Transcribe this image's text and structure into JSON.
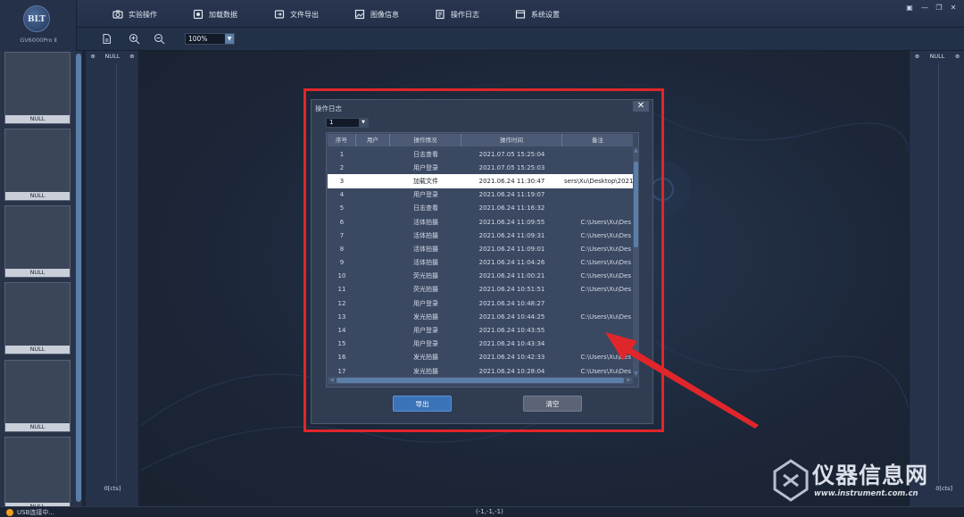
{
  "app": {
    "logo_text": "BLT",
    "product_name": "GV6000Pro Ⅱ"
  },
  "menu": [
    {
      "label": "实验操作",
      "icon": "camera-icon"
    },
    {
      "label": "加载数据",
      "icon": "load-data-icon"
    },
    {
      "label": "文件导出",
      "icon": "folder-export-icon"
    },
    {
      "label": "图像信息",
      "icon": "image-info-icon"
    },
    {
      "label": "操作日志",
      "icon": "log-icon"
    },
    {
      "label": "系统设置",
      "icon": "settings-icon"
    }
  ],
  "toolbar": {
    "zoom_value": "100%"
  },
  "thumbnails": [
    "NULL",
    "NULL",
    "NULL",
    "NULL",
    "NULL",
    "NULL"
  ],
  "left_panel": {
    "title": "NULL",
    "footer": "0[cts]"
  },
  "right_panel": {
    "title": "NULL",
    "footer": "0[cts]"
  },
  "dialog": {
    "title": "操作日志",
    "close_label": "✕",
    "page_value": "1",
    "columns": [
      "序号",
      "用户",
      "操作情况",
      "操作时间",
      "备注"
    ],
    "rows": [
      {
        "no": "1",
        "user": "",
        "op": "日志查看",
        "time": "2021.07.05 15:25:04",
        "note": ""
      },
      {
        "no": "2",
        "user": "",
        "op": "用户登录",
        "time": "2021.07.05 15:25:03",
        "note": ""
      },
      {
        "no": "3",
        "user": "",
        "op": "加载文件",
        "time": "2021.06.24 11:30:47",
        "note": "sers\\Xu\\Desktop\\2021"
      },
      {
        "no": "4",
        "user": "",
        "op": "用户登录",
        "time": "2021.06.24 11:19:07",
        "note": ""
      },
      {
        "no": "5",
        "user": "",
        "op": "日志查看",
        "time": "2021.06.24 11:16:32",
        "note": ""
      },
      {
        "no": "6",
        "user": "",
        "op": "活体拍摄",
        "time": "2021.06.24 11:09:55",
        "note": "C:\\Users\\Xu\\Des"
      },
      {
        "no": "7",
        "user": "",
        "op": "活体拍摄",
        "time": "2021.06.24 11:09:31",
        "note": "C:\\Users\\Xu\\Des"
      },
      {
        "no": "8",
        "user": "",
        "op": "活体拍摄",
        "time": "2021.06.24 11:09:01",
        "note": "C:\\Users\\Xu\\Des"
      },
      {
        "no": "9",
        "user": "",
        "op": "活体拍摄",
        "time": "2021.06.24 11:04:26",
        "note": "C:\\Users\\Xu\\Des"
      },
      {
        "no": "10",
        "user": "",
        "op": "荧光拍摄",
        "time": "2021.06.24 11:00:21",
        "note": "C:\\Users\\Xu\\Des"
      },
      {
        "no": "11",
        "user": "",
        "op": "荧光拍摄",
        "time": "2021.06.24 10:51:51",
        "note": "C:\\Users\\Xu\\Des"
      },
      {
        "no": "12",
        "user": "",
        "op": "用户登录",
        "time": "2021.06.24 10:48:27",
        "note": ""
      },
      {
        "no": "13",
        "user": "",
        "op": "发光拍摄",
        "time": "2021.06.24 10:44:25",
        "note": "C:\\Users\\Xu\\Des"
      },
      {
        "no": "14",
        "user": "",
        "op": "用户登录",
        "time": "2021.06.24 10:43:55",
        "note": ""
      },
      {
        "no": "15",
        "user": "",
        "op": "用户登录",
        "time": "2021.06.24 10:43:34",
        "note": ""
      },
      {
        "no": "16",
        "user": "",
        "op": "发光拍摄",
        "time": "2021.06.24 10:42:33",
        "note": "C:\\Users\\Xu\\Des"
      },
      {
        "no": "17",
        "user": "",
        "op": "发光拍摄",
        "time": "2021.06.24 10:28:04",
        "note": "C:\\Users\\Xu\\Des"
      }
    ],
    "selected_row": 3,
    "export_label": "导出",
    "clear_label": "清空"
  },
  "status": {
    "text": "USB连接中...",
    "coords": "(-1,-1,-1)"
  },
  "watermark": {
    "text": "仪器信息网",
    "url": "www.instrument.com.cn"
  },
  "colors": {
    "highlight": "#e0262a",
    "accent": "#3a73b8"
  }
}
